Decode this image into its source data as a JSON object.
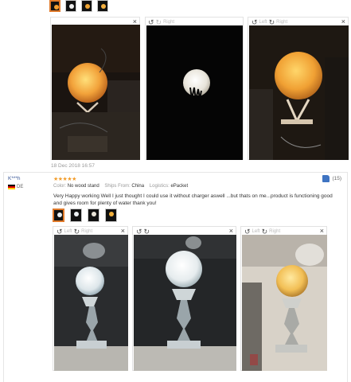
{
  "review_top": {
    "date": "18 Dec 2018 16:57",
    "viewer_left_label": "Left",
    "viewer_right_label": "Right",
    "close_symbol": "×"
  },
  "review_second": {
    "user": "K***h",
    "country": "DE",
    "stars": "★★★★★",
    "color_label": "Color:",
    "color_value": "No wood stand",
    "ships_label": "Ships From:",
    "ships_value": "China",
    "logistics_label": "Logistics:",
    "logistics_value": "ePacket",
    "likes": "(15)",
    "text": "Very Happy working Well I just thought I could use it without charger aswell ...but thats on me...product is functioning good and gives room for plenty of water thank you!",
    "viewer_left_label": "Left",
    "viewer_right_label": "Right",
    "close_symbol": "×"
  },
  "colors": {
    "accent": "#e07a2a",
    "stars": "#f29c2a",
    "username": "#3b5998",
    "like_icon": "#3f74c2"
  }
}
